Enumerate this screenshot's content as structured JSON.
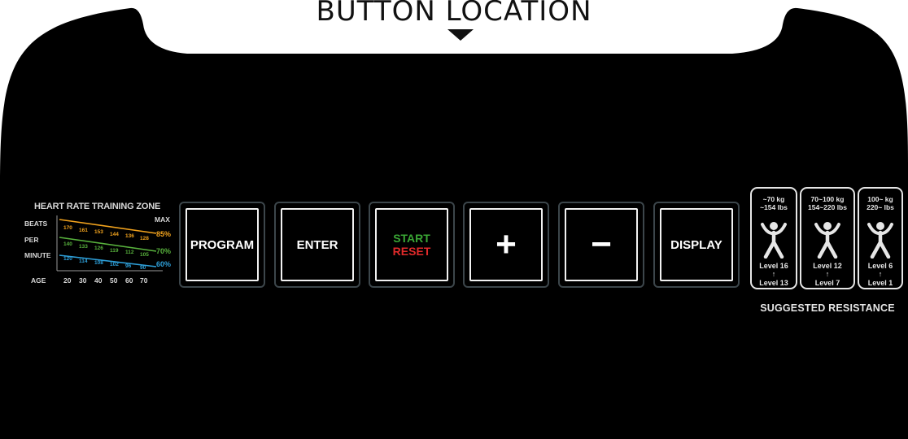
{
  "header": {
    "title": "BUTTON LOCATION",
    "arrow_icon": "triangle-down-icon"
  },
  "console": {
    "background_color": "#000000"
  },
  "heart_rate": {
    "title": "HEART RATE TRAINING ZONE",
    "labels": {
      "beats": "BEATS",
      "per": "PER",
      "minute": "MINUTE",
      "max": "MAX",
      "age": "AGE"
    },
    "ages": [
      "20",
      "30",
      "40",
      "50",
      "60",
      "70"
    ],
    "zones": [
      {
        "percent": "85%",
        "color": "#f2a31d",
        "values": [
          "170",
          "161",
          "153",
          "144",
          "136",
          "128"
        ]
      },
      {
        "percent": "70%",
        "color": "#58b23d",
        "values": [
          "140",
          "133",
          "126",
          "119",
          "112",
          "105"
        ]
      },
      {
        "percent": "60%",
        "color": "#2e9fd8",
        "values": [
          "120",
          "114",
          "108",
          "102",
          "96",
          "90"
        ]
      }
    ]
  },
  "buttons": {
    "program": "PROGRAM",
    "enter": "ENTER",
    "start": "START",
    "reset": "RESET",
    "plus": "+",
    "minus": "−",
    "display": "DISPLAY",
    "start_color": "#3aa635",
    "reset_color": "#e02a2a"
  },
  "resistance": {
    "caption": "SUGGESTED RESISTANCE",
    "icon": "exercising-person-icon",
    "groups": [
      {
        "weight_kg": "~70 kg",
        "weight_lbs": "~154 lbs",
        "level_high": "Level 16",
        "level_low": "Level 13"
      },
      {
        "weight_kg": "70~100 kg",
        "weight_lbs": "154~220 lbs",
        "level_high": "Level 12",
        "level_low": "Level 7"
      },
      {
        "weight_kg": "100~ kg",
        "weight_lbs": "220~ lbs",
        "level_high": "Level 6",
        "level_low": "Level 1"
      }
    ]
  }
}
